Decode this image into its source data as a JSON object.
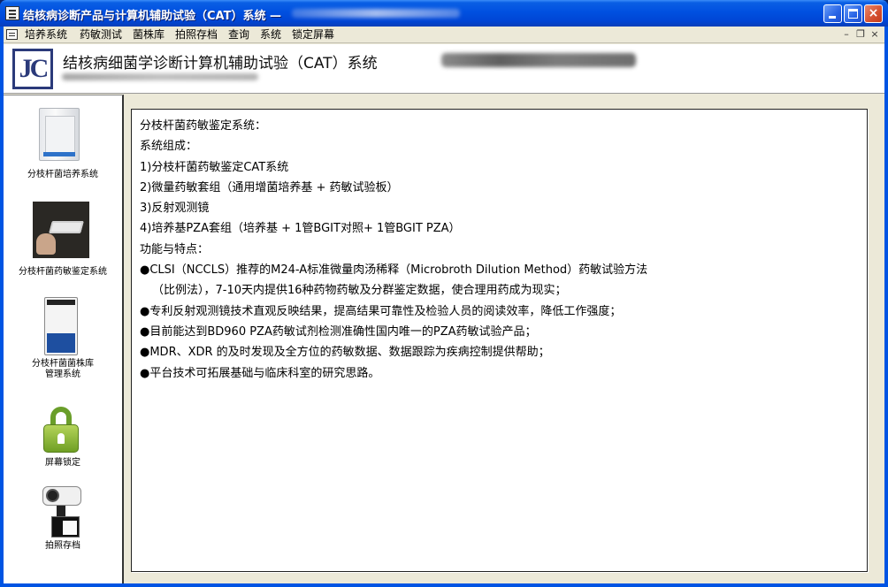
{
  "window": {
    "title": "结核病诊断产品与计算机辅助试验（CAT）系统 —",
    "buttons": {
      "minimize": "_",
      "maximize": "□",
      "close": "×"
    }
  },
  "menu": {
    "items": [
      "培养系统",
      "药敏测试",
      "菌株库",
      "拍照存档",
      "查询",
      "系统",
      "锁定屏幕"
    ],
    "mdi": {
      "minimize": "–",
      "restore": "❐",
      "close": "×"
    }
  },
  "header": {
    "logo_text": "JC",
    "title": "结核病细菌学诊断计算机辅助试验（CAT）系统"
  },
  "sidebar": {
    "items": [
      {
        "label": "分枝杆菌培养系统",
        "icon": "incubator-icon"
      },
      {
        "label": "分枝杆菌药敏鉴定系统",
        "icon": "test-plate-photo-icon"
      },
      {
        "label_line1": "分枝杆菌菌株库",
        "label_line2": "管理系统",
        "icon": "strain-cabinet-icon"
      },
      {
        "label": "屏幕锁定",
        "icon": "lock-icon"
      },
      {
        "label": "拍照存档",
        "icon": "camera-icon"
      }
    ]
  },
  "content": {
    "lines": [
      "分枝杆菌药敏鉴定系统：",
      "系统组成：",
      "1)分枝杆菌药敏鉴定CAT系统",
      "2)微量药敏套组（通用增菌培养基 + 药敏试验板）",
      "3)反射观测镜",
      "4)培养基PZA套组（培养基 + 1管BGIT对照+ 1管BGIT PZA）",
      "功能与特点：",
      "●CLSI（NCCLS）推荐的M24-A标准微量肉汤稀释（Microbroth Dilution Method）药敏试验方法",
      "（比例法），7-10天内提供16种药物药敏及分群鉴定数据，使合理用药成为现实；",
      "●专利反射观测镜技术直观反映结果，提高结果可靠性及检验人员的阅读效率，降低工作强度；",
      "●目前能达到BD960 PZA药敏试剂检测准确性国内唯一的PZA药敏试验产品；",
      "●MDR、XDR 的及时发现及全方位的药敏数据、数据跟踪为疾病控制提供帮助；",
      "●平台技术可拓展基础与临床科室的研究思路。"
    ]
  },
  "colors": {
    "titlebar": "#0054e3",
    "client_bg": "#ece9d8",
    "logo": "#2b3a7a",
    "lock_green": "#6f9f24"
  }
}
